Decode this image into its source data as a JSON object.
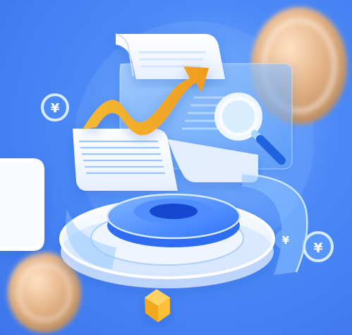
{
  "scene": {
    "description_hidden": "",
    "currency_symbol": "¥",
    "colors": {
      "background": "#4a86f5",
      "accent_orange": "#f6ad2c",
      "glass_blue": "#8cc3ff",
      "platform_white": "#f4f8ff",
      "coin": "#e8b98a"
    },
    "icons": [
      "yen-coin-icon",
      "magnifier-icon",
      "document-icon",
      "trend-arrow-icon",
      "glass-panel-icon",
      "platform-icon",
      "cube-icon",
      "card-icon"
    ]
  }
}
